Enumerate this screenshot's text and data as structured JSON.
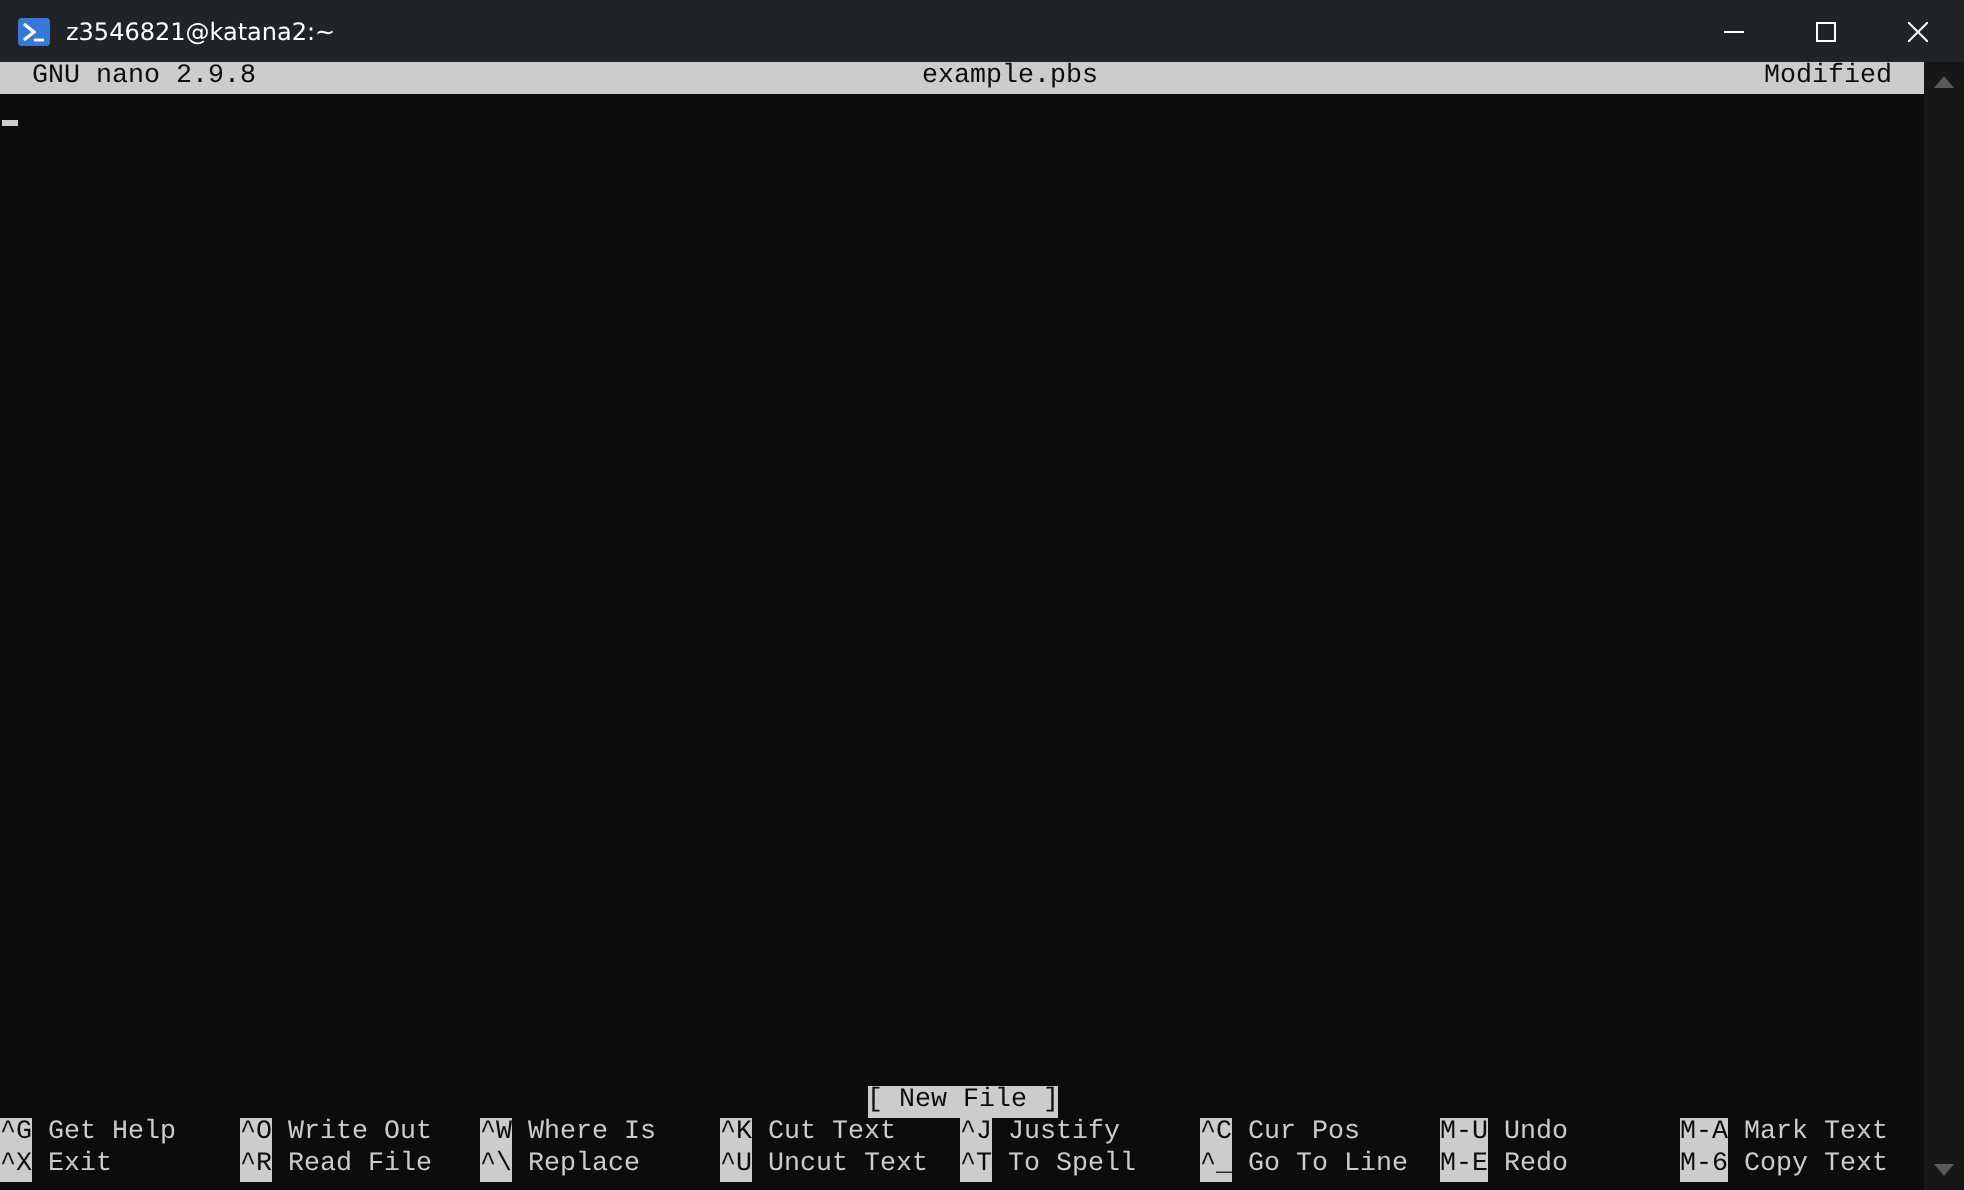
{
  "window": {
    "title": "z3546821@katana2:~"
  },
  "header": {
    "app": "GNU nano 2.9.8",
    "filename": "example.pbs",
    "state": "Modified"
  },
  "status": "[ New File ]",
  "shortcuts": [
    [
      {
        "key": "^G",
        "label": "Get Help"
      },
      {
        "key": "^O",
        "label": "Write Out"
      },
      {
        "key": "^W",
        "label": "Where Is"
      },
      {
        "key": "^K",
        "label": "Cut Text"
      },
      {
        "key": "^J",
        "label": "Justify"
      },
      {
        "key": "^C",
        "label": "Cur Pos"
      },
      {
        "key": "M-U",
        "label": "Undo"
      },
      {
        "key": "M-A",
        "label": "Mark Text"
      }
    ],
    [
      {
        "key": "^X",
        "label": "Exit"
      },
      {
        "key": "^R",
        "label": "Read File"
      },
      {
        "key": "^\\",
        "label": "Replace"
      },
      {
        "key": "^U",
        "label": "Uncut Text"
      },
      {
        "key": "^T",
        "label": "To Spell"
      },
      {
        "key": "^_",
        "label": "Go To Line"
      },
      {
        "key": "M-E",
        "label": "Redo"
      },
      {
        "key": "M-6",
        "label": "Copy Text"
      }
    ]
  ]
}
